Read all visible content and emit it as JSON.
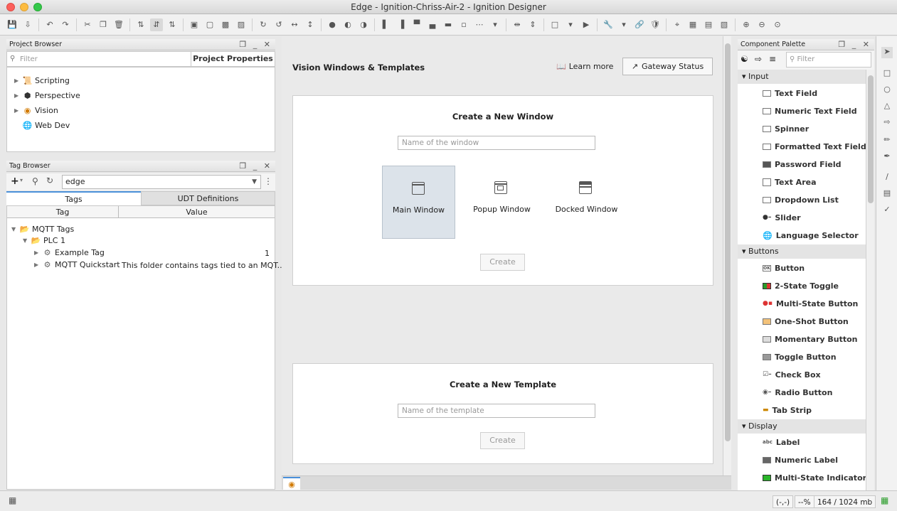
{
  "window": {
    "title": "Edge - Ignition-Chriss-Air-2 - Ignition Designer"
  },
  "project_browser": {
    "title": "Project Browser",
    "filter_placeholder": "Filter",
    "project_properties_label": "Project Properties",
    "items": [
      {
        "label": "Scripting"
      },
      {
        "label": "Perspective"
      },
      {
        "label": "Vision"
      },
      {
        "label": "Web Dev"
      }
    ]
  },
  "tag_browser": {
    "title": "Tag Browser",
    "search_value": "edge",
    "tabs": [
      "Tags",
      "UDT Definitions"
    ],
    "columns": [
      "Tag",
      "Value"
    ],
    "rows": [
      {
        "tag": "MQTT Tags",
        "value": ""
      },
      {
        "tag": "PLC 1",
        "value": ""
      },
      {
        "tag": "Example Tag",
        "value": "1"
      },
      {
        "tag": "MQTT Quickstart",
        "value": "This folder contains tags tied to an MQT..."
      }
    ]
  },
  "center": {
    "title": "Vision Windows & Templates",
    "learn_more": "Learn more",
    "gateway_status": "Gateway Status",
    "new_window": {
      "title": "Create a New Window",
      "placeholder": "Name of the window",
      "types": [
        "Main Window",
        "Popup Window",
        "Docked Window"
      ],
      "create_label": "Create"
    },
    "new_template": {
      "title": "Create a New Template",
      "placeholder": "Name of the template",
      "create_label": "Create"
    }
  },
  "component_palette": {
    "title": "Component Palette",
    "filter_placeholder": "Filter",
    "categories": [
      {
        "name": "Input",
        "items": [
          "Text Field",
          "Numeric Text Field",
          "Spinner",
          "Formatted Text Field",
          "Password Field",
          "Text Area",
          "Dropdown List",
          "Slider",
          "Language Selector"
        ]
      },
      {
        "name": "Buttons",
        "items": [
          "Button",
          "2-State Toggle",
          "Multi-State Button",
          "One-Shot Button",
          "Momentary Button",
          "Toggle Button",
          "Check Box",
          "Radio Button",
          "Tab Strip"
        ]
      },
      {
        "name": "Display",
        "items": [
          "Label",
          "Numeric Label",
          "Multi-State Indicator"
        ]
      }
    ]
  },
  "statusbar": {
    "coords": "(-,-)",
    "zoom": "--%",
    "memory": "164 / 1024 mb"
  },
  "colors": {
    "accent": "#4a90d9",
    "selected_window": "#dce3ea"
  }
}
